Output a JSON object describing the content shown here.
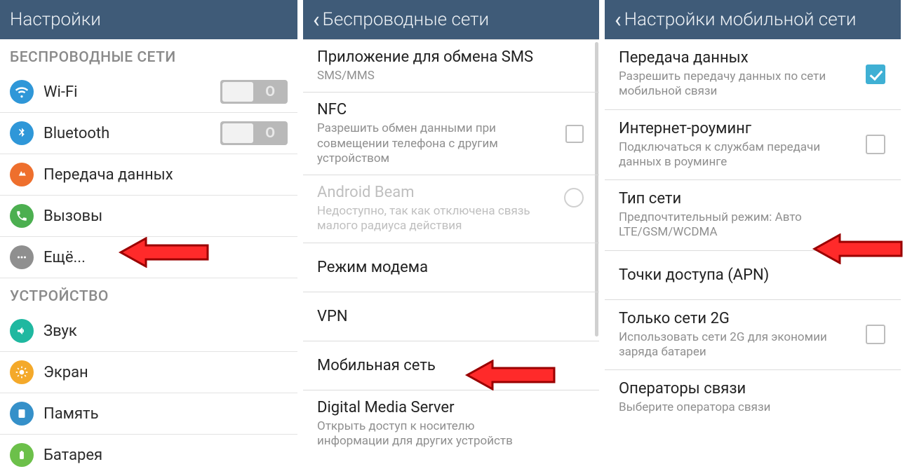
{
  "panel1": {
    "header": "Настройки",
    "section_wireless": "БЕСПРОВОДНЫЕ СЕТИ",
    "wifi": "Wi-Fi",
    "bluetooth": "Bluetooth",
    "data": "Передача данных",
    "calls": "Вызовы",
    "more": "Ещё...",
    "section_device": "УСТРОЙСТВО",
    "sound": "Звук",
    "display": "Экран",
    "memory": "Память",
    "battery": "Батарея",
    "toggle_off": "O"
  },
  "panel2": {
    "header": "Беспроводные сети",
    "sms_title": "Приложение для обмена SMS",
    "sms_desc": "SMS/MMS",
    "nfc_title": "NFC",
    "nfc_desc": "Разрешить обмен данными при совмещении телефона с другим устройством",
    "beam_title": "Android Beam",
    "beam_desc": "Недоступно, так как отключена связь малого радиуса действия",
    "tether": "Режим модема",
    "vpn": "VPN",
    "mobile": "Мобильная сеть",
    "dms_title": "Digital Media Server",
    "dms_desc": "Открыть доступ к носителю информации для других устройств"
  },
  "panel3": {
    "header": "Настройки мобильной сети",
    "data_title": "Передача данных",
    "data_desc": "Разрешить передачу данных по сети мобильной связи",
    "roam_title": "Интернет-роуминг",
    "roam_desc": "Подключаться к службам передачи данных в роуминге",
    "type_title": "Тип сети",
    "type_desc": "Предпочтительный режим: Авто LTE/GSM/WCDMA",
    "apn_title": "Точки доступа (APN)",
    "only2g_title": "Только сети 2G",
    "only2g_desc": "Использовать сети 2G для экономии заряда батареи",
    "ops_title": "Операторы связи",
    "ops_desc": "Выберите оператора связи"
  }
}
